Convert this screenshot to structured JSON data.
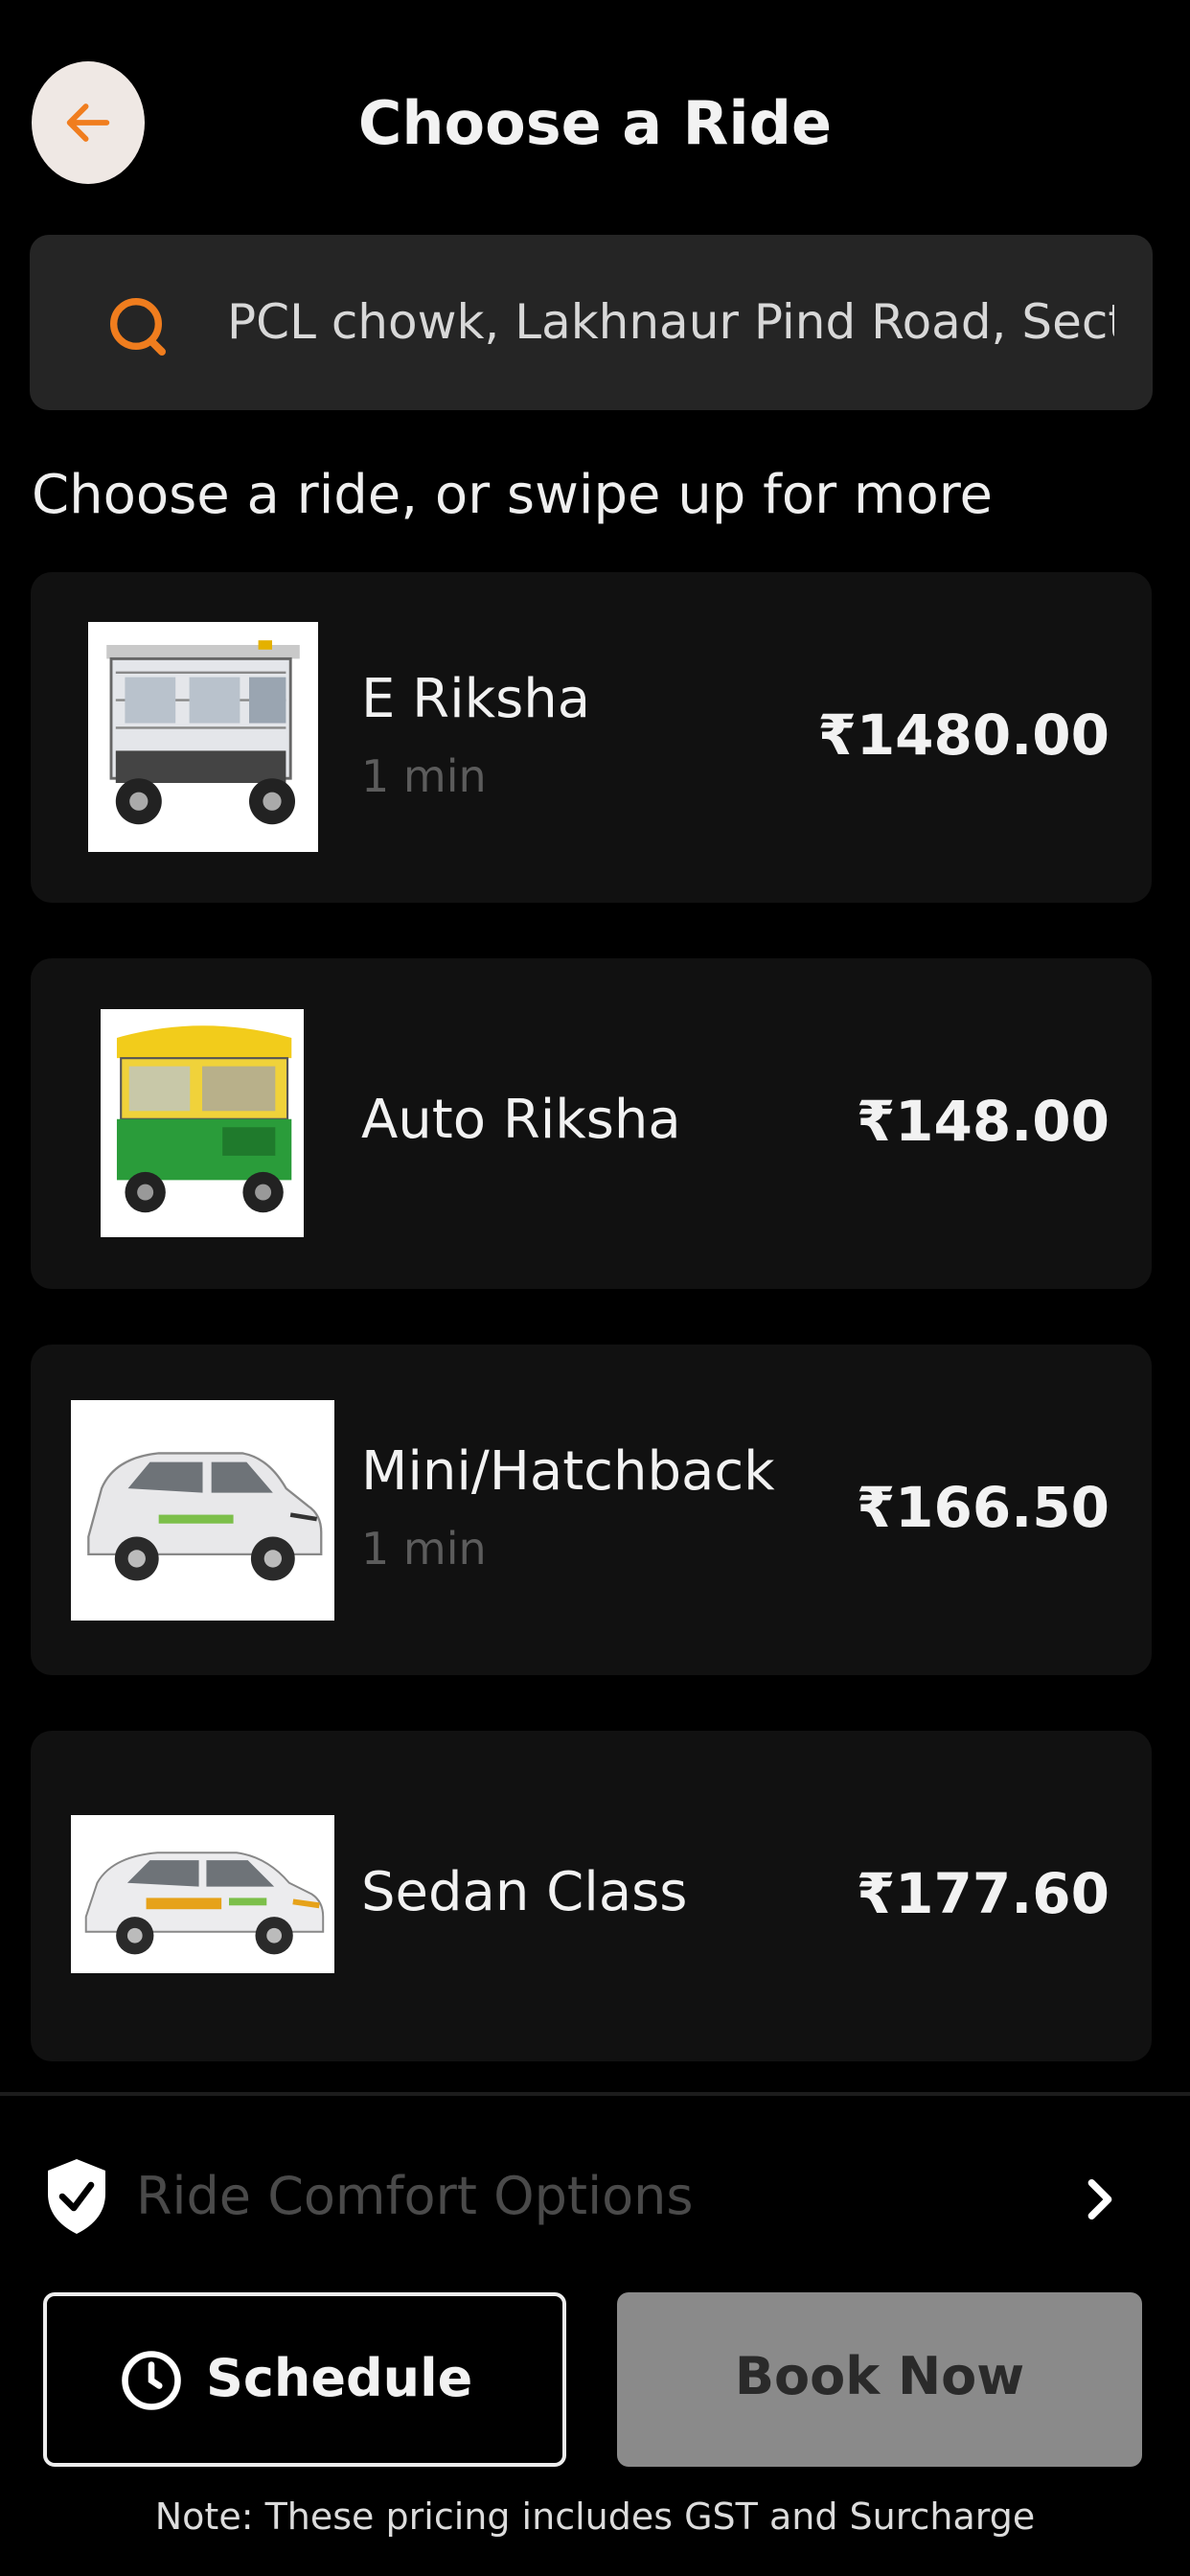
{
  "header": {
    "title": "Choose a Ride",
    "back_icon": "arrow-left-icon",
    "accent": "#f07d1e"
  },
  "search": {
    "value": "PCL chowk, Lakhnaur Pind Road, Sector",
    "icon": "search-icon"
  },
  "section_heading": "Choose a ride, or swipe up for more",
  "rides": [
    {
      "name": "E Riksha",
      "eta": "1 min",
      "price": "₹1480.00",
      "image": "e-riksha-image"
    },
    {
      "name": "Auto Riksha",
      "eta": "",
      "price": "₹148.00",
      "image": "auto-riksha-image"
    },
    {
      "name": "Mini/Hatchback",
      "eta": "1 min",
      "price": "₹166.50",
      "image": "hatchback-car-image"
    },
    {
      "name": "Sedan Class",
      "eta": "",
      "price": "₹177.60",
      "image": "sedan-car-image"
    }
  ],
  "comfort": {
    "label": "Ride Comfort Options",
    "icon": "shield-check-icon"
  },
  "buttons": {
    "schedule": "Schedule",
    "book_now": "Book Now"
  },
  "note": "Note: These pricing includes GST and Surcharge"
}
